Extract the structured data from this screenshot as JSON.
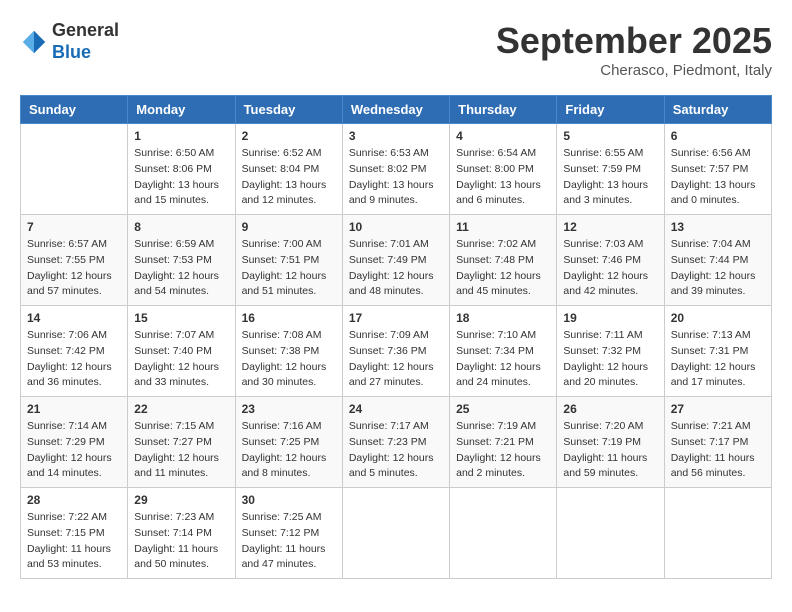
{
  "header": {
    "logo_general": "General",
    "logo_blue": "Blue",
    "month_title": "September 2025",
    "location": "Cherasco, Piedmont, Italy"
  },
  "columns": [
    "Sunday",
    "Monday",
    "Tuesday",
    "Wednesday",
    "Thursday",
    "Friday",
    "Saturday"
  ],
  "weeks": [
    [
      {
        "day": "",
        "info": ""
      },
      {
        "day": "1",
        "info": "Sunrise: 6:50 AM\nSunset: 8:06 PM\nDaylight: 13 hours\nand 15 minutes."
      },
      {
        "day": "2",
        "info": "Sunrise: 6:52 AM\nSunset: 8:04 PM\nDaylight: 13 hours\nand 12 minutes."
      },
      {
        "day": "3",
        "info": "Sunrise: 6:53 AM\nSunset: 8:02 PM\nDaylight: 13 hours\nand 9 minutes."
      },
      {
        "day": "4",
        "info": "Sunrise: 6:54 AM\nSunset: 8:00 PM\nDaylight: 13 hours\nand 6 minutes."
      },
      {
        "day": "5",
        "info": "Sunrise: 6:55 AM\nSunset: 7:59 PM\nDaylight: 13 hours\nand 3 minutes."
      },
      {
        "day": "6",
        "info": "Sunrise: 6:56 AM\nSunset: 7:57 PM\nDaylight: 13 hours\nand 0 minutes."
      }
    ],
    [
      {
        "day": "7",
        "info": "Sunrise: 6:57 AM\nSunset: 7:55 PM\nDaylight: 12 hours\nand 57 minutes."
      },
      {
        "day": "8",
        "info": "Sunrise: 6:59 AM\nSunset: 7:53 PM\nDaylight: 12 hours\nand 54 minutes."
      },
      {
        "day": "9",
        "info": "Sunrise: 7:00 AM\nSunset: 7:51 PM\nDaylight: 12 hours\nand 51 minutes."
      },
      {
        "day": "10",
        "info": "Sunrise: 7:01 AM\nSunset: 7:49 PM\nDaylight: 12 hours\nand 48 minutes."
      },
      {
        "day": "11",
        "info": "Sunrise: 7:02 AM\nSunset: 7:48 PM\nDaylight: 12 hours\nand 45 minutes."
      },
      {
        "day": "12",
        "info": "Sunrise: 7:03 AM\nSunset: 7:46 PM\nDaylight: 12 hours\nand 42 minutes."
      },
      {
        "day": "13",
        "info": "Sunrise: 7:04 AM\nSunset: 7:44 PM\nDaylight: 12 hours\nand 39 minutes."
      }
    ],
    [
      {
        "day": "14",
        "info": "Sunrise: 7:06 AM\nSunset: 7:42 PM\nDaylight: 12 hours\nand 36 minutes."
      },
      {
        "day": "15",
        "info": "Sunrise: 7:07 AM\nSunset: 7:40 PM\nDaylight: 12 hours\nand 33 minutes."
      },
      {
        "day": "16",
        "info": "Sunrise: 7:08 AM\nSunset: 7:38 PM\nDaylight: 12 hours\nand 30 minutes."
      },
      {
        "day": "17",
        "info": "Sunrise: 7:09 AM\nSunset: 7:36 PM\nDaylight: 12 hours\nand 27 minutes."
      },
      {
        "day": "18",
        "info": "Sunrise: 7:10 AM\nSunset: 7:34 PM\nDaylight: 12 hours\nand 24 minutes."
      },
      {
        "day": "19",
        "info": "Sunrise: 7:11 AM\nSunset: 7:32 PM\nDaylight: 12 hours\nand 20 minutes."
      },
      {
        "day": "20",
        "info": "Sunrise: 7:13 AM\nSunset: 7:31 PM\nDaylight: 12 hours\nand 17 minutes."
      }
    ],
    [
      {
        "day": "21",
        "info": "Sunrise: 7:14 AM\nSunset: 7:29 PM\nDaylight: 12 hours\nand 14 minutes."
      },
      {
        "day": "22",
        "info": "Sunrise: 7:15 AM\nSunset: 7:27 PM\nDaylight: 12 hours\nand 11 minutes."
      },
      {
        "day": "23",
        "info": "Sunrise: 7:16 AM\nSunset: 7:25 PM\nDaylight: 12 hours\nand 8 minutes."
      },
      {
        "day": "24",
        "info": "Sunrise: 7:17 AM\nSunset: 7:23 PM\nDaylight: 12 hours\nand 5 minutes."
      },
      {
        "day": "25",
        "info": "Sunrise: 7:19 AM\nSunset: 7:21 PM\nDaylight: 12 hours\nand 2 minutes."
      },
      {
        "day": "26",
        "info": "Sunrise: 7:20 AM\nSunset: 7:19 PM\nDaylight: 11 hours\nand 59 minutes."
      },
      {
        "day": "27",
        "info": "Sunrise: 7:21 AM\nSunset: 7:17 PM\nDaylight: 11 hours\nand 56 minutes."
      }
    ],
    [
      {
        "day": "28",
        "info": "Sunrise: 7:22 AM\nSunset: 7:15 PM\nDaylight: 11 hours\nand 53 minutes."
      },
      {
        "day": "29",
        "info": "Sunrise: 7:23 AM\nSunset: 7:14 PM\nDaylight: 11 hours\nand 50 minutes."
      },
      {
        "day": "30",
        "info": "Sunrise: 7:25 AM\nSunset: 7:12 PM\nDaylight: 11 hours\nand 47 minutes."
      },
      {
        "day": "",
        "info": ""
      },
      {
        "day": "",
        "info": ""
      },
      {
        "day": "",
        "info": ""
      },
      {
        "day": "",
        "info": ""
      }
    ]
  ]
}
